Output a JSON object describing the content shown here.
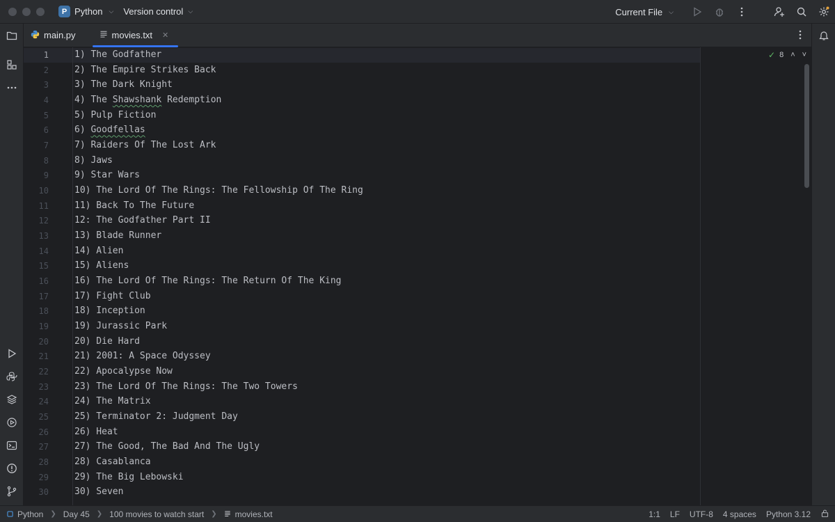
{
  "titlebar": {
    "project_badge": "P",
    "project_name": "Python",
    "vcs_label": "Version control",
    "run_config": "Current File"
  },
  "tabs": [
    {
      "label": "main.py",
      "icon": "python-file-icon",
      "active": false
    },
    {
      "label": "movies.txt",
      "icon": "text-file-icon",
      "active": true
    }
  ],
  "editor": {
    "inspection_count": "8",
    "lines": [
      "1) The Godfather",
      "2) The Empire Strikes Back",
      "3) The Dark Knight",
      "4) The Shawshank Redemption",
      "5) Pulp Fiction",
      "6) Goodfellas",
      "7) Raiders Of The Lost Ark",
      "8) Jaws",
      "9) Star Wars",
      "10) The Lord Of The Rings: The Fellowship Of The Ring",
      "11) Back To The Future",
      "12: The Godfather Part II",
      "13) Blade Runner",
      "14) Alien",
      "15) Aliens",
      "16) The Lord Of The Rings: The Return Of The King",
      "17) Fight Club",
      "18) Inception",
      "19) Jurassic Park",
      "20) Die Hard",
      "21) 2001: A Space Odyssey",
      "22) Apocalypse Now",
      "23) The Lord Of The Rings: The Two Towers",
      "24) The Matrix",
      "25) Terminator 2: Judgment Day",
      "26) Heat",
      "27) The Good, The Bad And The Ugly",
      "28) Casablanca",
      "29) The Big Lebowski",
      "30) Seven"
    ],
    "line_numbers": [
      "1",
      "2",
      "3",
      "4",
      "5",
      "6",
      "7",
      "8",
      "9",
      "10",
      "11",
      "12",
      "13",
      "14",
      "15",
      "16",
      "17",
      "18",
      "19",
      "20",
      "21",
      "22",
      "23",
      "24",
      "25",
      "26",
      "27",
      "28",
      "29",
      "30"
    ],
    "typos": [
      "Shawshank",
      "Goodfellas"
    ]
  },
  "statusbar": {
    "breadcrumbs": [
      "Python",
      "Day 45",
      "100 movies to watch start",
      "movies.txt"
    ],
    "position": "1:1",
    "line_ending": "LF",
    "encoding": "UTF-8",
    "indent": "4 spaces",
    "interpreter": "Python 3.12"
  },
  "colors": {
    "accent": "#3574f0",
    "background": "#1e1f22",
    "chrome": "#2b2d30"
  }
}
